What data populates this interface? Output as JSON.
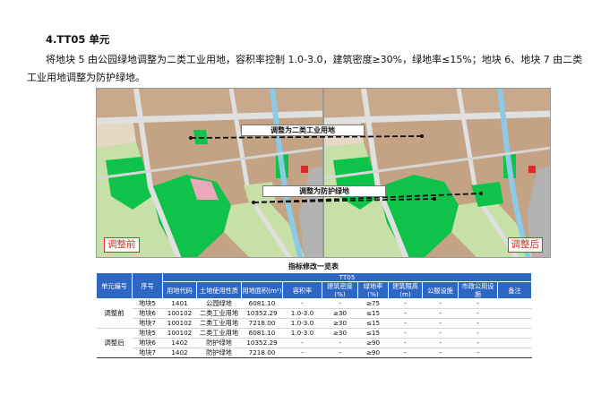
{
  "heading": "4.TT05 单元",
  "paragraph": "将地块 5 由公园绿地调整为二类工业用地，容积率控制 1.0-3.0，建筑密度≥30%，绿地率≤15%；地块 6、地块 7 由二类工业用地调整为防护绿地。",
  "maps": {
    "before_label": "调整前",
    "after_label": "调整后",
    "callout_top": "调整为二类工业用地",
    "callout_bottom": "调整为防护绿地"
  },
  "colors": {
    "industrial": "#c4a284",
    "green": "#0ec24a",
    "light_green": "#c6e0a8",
    "water": "#8bcbe8",
    "road": "#d9d9d9",
    "header_blue": "#2e66c3",
    "tag_red": "#d6322b"
  },
  "table": {
    "title": "指标修改一览表",
    "group_header": "TT05",
    "headers": [
      "单元编号",
      "序号",
      "用地代码",
      "土地使用性质",
      "用地面积(m²)",
      "容积率",
      "建筑密度(%)",
      "绿地率(%)",
      "建筑限高(m)",
      "公服设施",
      "市政公用设施",
      "备注"
    ],
    "groups": [
      {
        "label": "调整前",
        "rows": [
          [
            "地块5",
            "1401",
            "公园绿地",
            "6081.10",
            "-",
            "-",
            "≥75",
            "-",
            "-",
            "-",
            ""
          ],
          [
            "地块6",
            "100102",
            "二类工业用地",
            "10352.29",
            "1.0-3.0",
            "≥30",
            "≤15",
            "-",
            "-",
            "-",
            ""
          ],
          [
            "地块7",
            "100102",
            "二类工业用地",
            "7218.00",
            "1.0-3.0",
            "≥30",
            "≤15",
            "-",
            "-",
            "-",
            ""
          ]
        ]
      },
      {
        "label": "调整后",
        "rows": [
          [
            "地块5",
            "100102",
            "二类工业用地",
            "6081.10",
            "1.0-3.0",
            "≥30",
            "≤15",
            "-",
            "-",
            "-",
            ""
          ],
          [
            "地块6",
            "1402",
            "防护绿地",
            "10352.29",
            "-",
            "-",
            "≥90",
            "-",
            "-",
            "-",
            ""
          ],
          [
            "地块7",
            "1402",
            "防护绿地",
            "7218.00",
            "-",
            "-",
            "≥90",
            "-",
            "-",
            "-",
            ""
          ]
        ]
      }
    ]
  }
}
